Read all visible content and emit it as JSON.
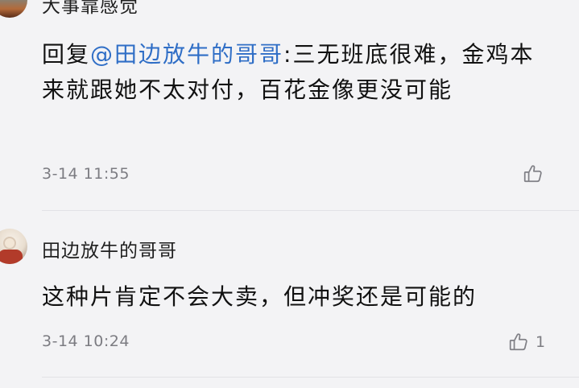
{
  "comments": [
    {
      "username": "大事靠感觉",
      "reply_prefix": "回复",
      "mention": "@田边放牛的哥哥",
      "text": ":三无班底很难，金鸡本来就跟她不太对付，百花金像更没可能",
      "timestamp": "3-14 11:55",
      "like_icon": "thumbs-up-icon",
      "like_count": ""
    },
    {
      "username": "田边放牛的哥哥",
      "text": "这种片肯定不会大卖，但冲奖还是可能的",
      "timestamp": "3-14 10:24",
      "like_icon": "thumbs-up-icon",
      "like_count": "1"
    }
  ],
  "colors": {
    "background": "#f3f3f5",
    "mention": "#2f6ec6",
    "meta_text": "#7c7c82",
    "divider": "#e2e2e6"
  }
}
